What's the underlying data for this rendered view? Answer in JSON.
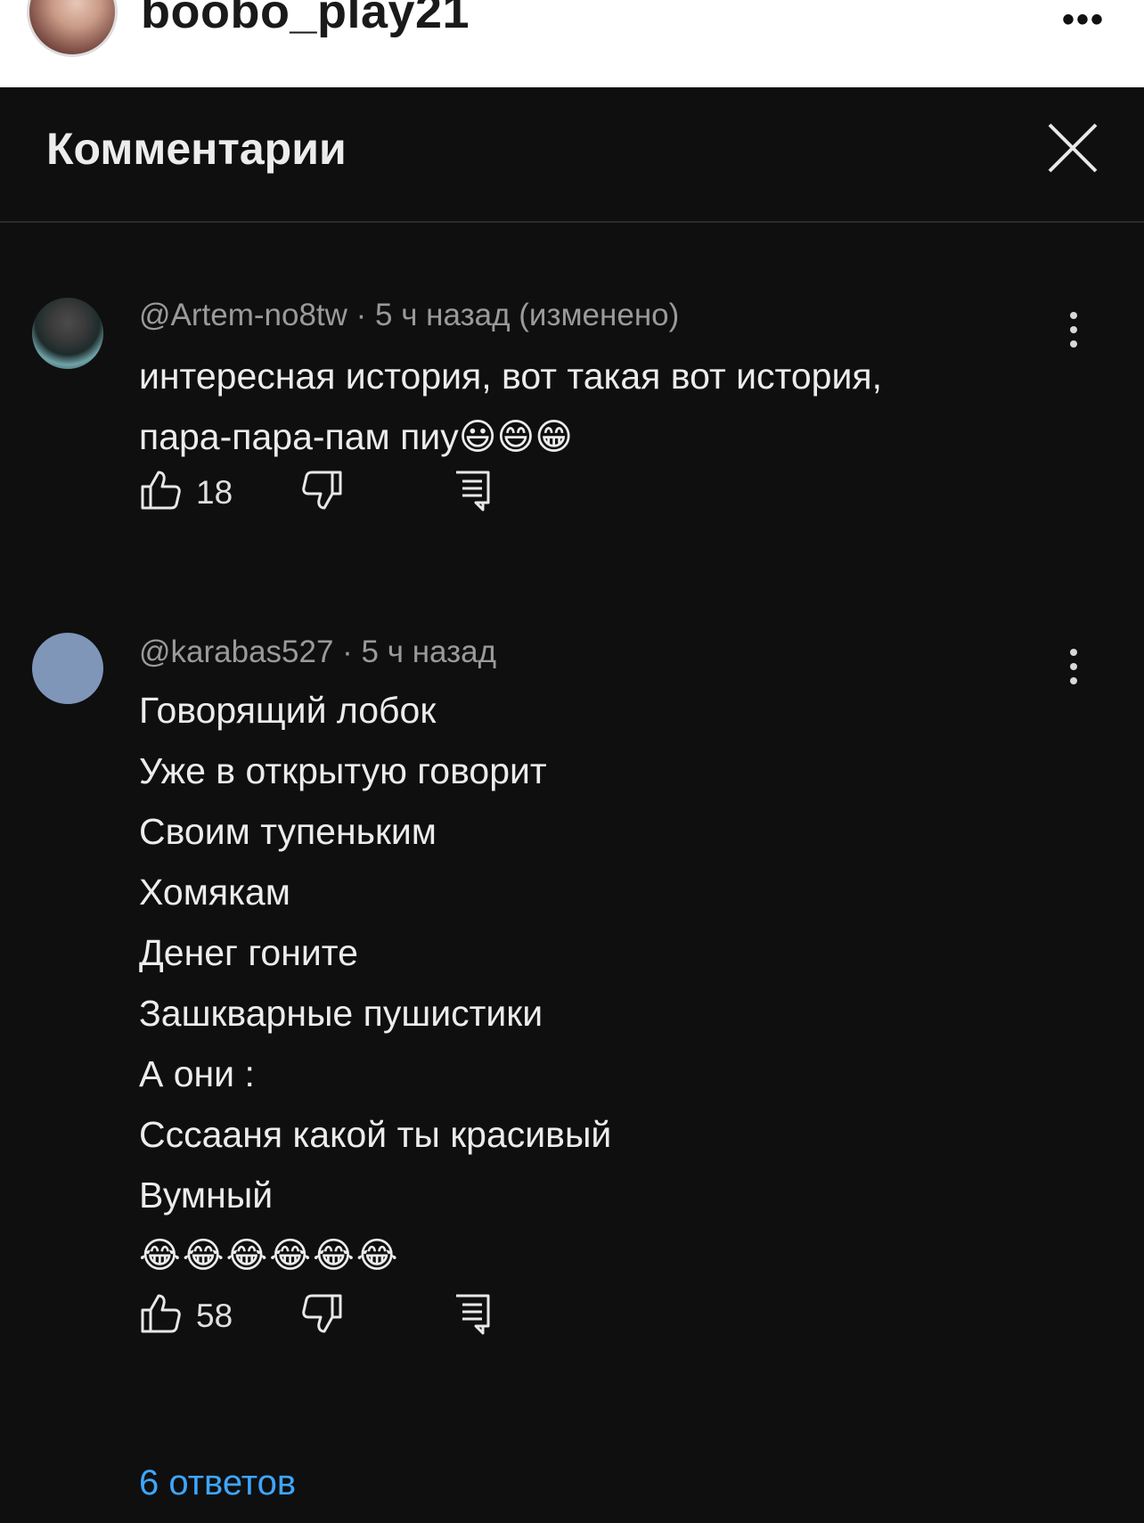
{
  "header": {
    "username": "boobo_play21",
    "more_label": "•••"
  },
  "panel": {
    "title": "Комментарии"
  },
  "comments": [
    {
      "meta": "@Artem-no8tw · 5 ч назад (изменено)",
      "lines": [
        "интересная история, вот такая вот история,",
        "пара-пара-пам пиу😃😄😁"
      ],
      "likes": "18"
    },
    {
      "meta": "@karabas527 · 5 ч назад",
      "lines": [
        "Говорящий лобок",
        "Уже в открытую говорит",
        "Своим тупеньким",
        "Хомякам",
        "Денег гоните",
        "Зашкварные пушистики",
        "А они :",
        "Сссааня какой ты красивый",
        "Вумный",
        "😂😂😂😂😂😂"
      ],
      "likes": "58"
    }
  ],
  "replies_label": "6 ответов",
  "colors": {
    "panel_bg": "#0f0f0f",
    "link": "#3ea6ff",
    "meta": "#9a9a9a"
  }
}
